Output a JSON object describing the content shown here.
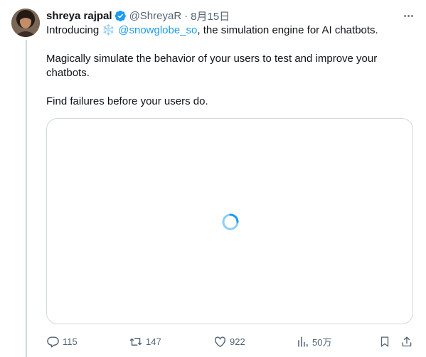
{
  "tweet": {
    "author": {
      "display_name": "shreya rajpal",
      "handle": "@ShreyaR",
      "verified": true
    },
    "separator": "·",
    "date": "8月15日",
    "text": {
      "intro_prefix": "Introducing ",
      "emoji": "❄️",
      "mention": "@snowglobe_so",
      "intro_suffix": ", the simulation engine for AI chatbots.",
      "paragraph2": "Magically simulate the behavior of your users to test and improve your chatbots.",
      "paragraph3": "Find failures before your users do."
    },
    "media": {
      "state": "loading"
    },
    "actions": {
      "replies": "115",
      "retweets": "147",
      "likes": "922",
      "views": "50万"
    },
    "icons": [
      "verified-badge-icon",
      "more-icon",
      "reply-icon",
      "retweet-icon",
      "like-icon",
      "views-icon",
      "bookmark-icon",
      "share-icon"
    ]
  },
  "colors": {
    "accent": "#1d9bf0",
    "text": "#0f1419",
    "muted": "#536471",
    "border": "#cfd9de"
  }
}
